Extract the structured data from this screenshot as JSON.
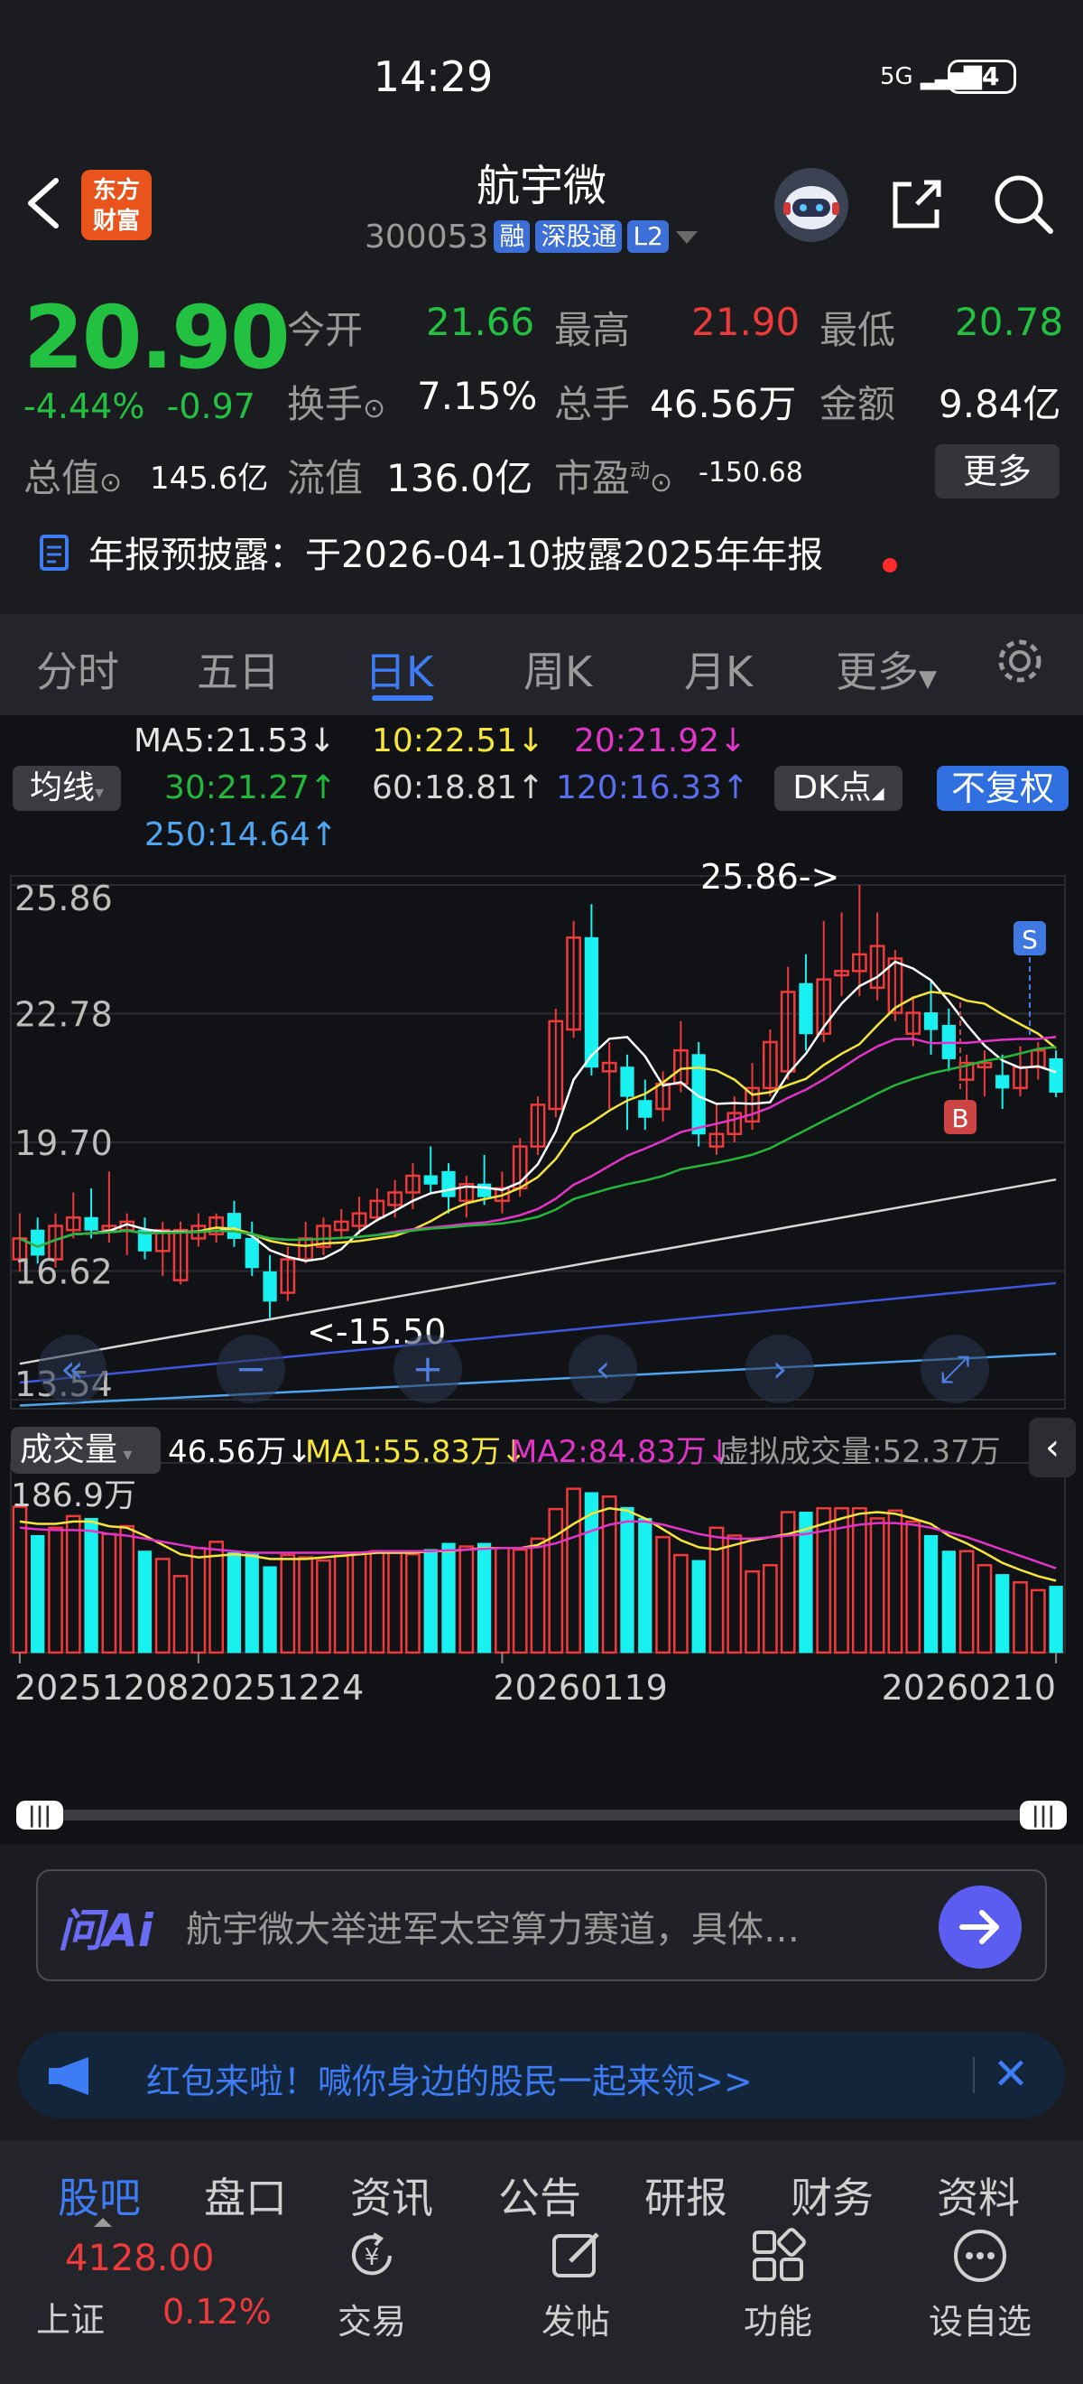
{
  "status": {
    "time": "14:29",
    "signal": "5G",
    "battery": "84"
  },
  "header": {
    "logo_line1": "东方",
    "logo_line2": "财富",
    "name": "航宇微",
    "code": "300053",
    "tags": [
      "融",
      "深股通",
      "L2"
    ]
  },
  "quote": {
    "price": "20.90",
    "change_pct": "-4.44%",
    "change": "-0.97",
    "labels": {
      "open": "今开",
      "high": "最高",
      "low": "最低",
      "turnover": "换手",
      "volume": "总手",
      "amount": "金额",
      "mktcap": "总值",
      "float": "流值",
      "pe": "市盈",
      "pe_sup": "动"
    },
    "values": {
      "open": "21.66",
      "high": "21.90",
      "low": "20.78",
      "turnover": "7.15%",
      "volume": "46.56万",
      "amount": "9.84亿",
      "mktcap": "145.6亿",
      "float": "136.0亿",
      "pe": "-150.68"
    },
    "more": "更多"
  },
  "notice": {
    "text": "年报预披露：于2026-04-10披露2025年年报"
  },
  "tabs": [
    "分时",
    "五日",
    "日K",
    "周K",
    "月K",
    "更多"
  ],
  "chart_controls": {
    "ma_chip": "均线",
    "dk_chip": "DK点",
    "fq_button": "不复权"
  },
  "ma_legend": {
    "ma5": "MA5:21.53↓",
    "ma10": "10:22.51↓",
    "ma20": "20:21.92↓",
    "ma30": "30:21.27↑",
    "ma60": "60:18.81↑",
    "ma120": "120:16.33↑",
    "ma250": "250:14.64↑"
  },
  "colors": {
    "ma5": "#ffffff",
    "ma10": "#f6e53a",
    "ma20": "#e234c8",
    "ma30": "#22b83a",
    "ma60": "#d8d8d8",
    "ma120": "#3f57e0",
    "ma250": "#4fa6f0",
    "up": "#ee3a3a",
    "down": "#19f0f0"
  },
  "volume_header": {
    "chip": "成交量",
    "vol": "46.56万↓",
    "ma1": "MA1:55.83万↓",
    "ma2": "MA2:84.83万↓",
    "virtual": "虚拟成交量:52.37万"
  },
  "chart_data": {
    "type": "candlestick",
    "y_ticks": [
      "25.86",
      "22.78",
      "19.70",
      "16.62",
      "13.54"
    ],
    "ylim": [
      13.54,
      25.86
    ],
    "annotations": {
      "high_label": "25.86->",
      "low_label": "<-15.50",
      "sell_marker": "S",
      "buy_marker": "B"
    },
    "x_labels": [
      "20251208",
      "20251224",
      "20260119",
      "20260210"
    ],
    "vol_max_label": "186.9万",
    "candles": [
      {
        "o": 16.9,
        "c": 17.4,
        "h": 18.0,
        "l": 16.6
      },
      {
        "o": 17.6,
        "c": 17.0,
        "h": 17.9,
        "l": 16.8
      },
      {
        "o": 16.9,
        "c": 17.7,
        "h": 18.0,
        "l": 16.7
      },
      {
        "o": 17.6,
        "c": 17.9,
        "h": 18.5,
        "l": 17.4
      },
      {
        "o": 17.9,
        "c": 17.6,
        "h": 18.6,
        "l": 17.4
      },
      {
        "o": 17.6,
        "c": 17.7,
        "h": 19.0,
        "l": 17.3
      },
      {
        "o": 17.6,
        "c": 17.8,
        "h": 18.0,
        "l": 17.0
      },
      {
        "o": 17.6,
        "c": 17.1,
        "h": 17.9,
        "l": 16.9
      },
      {
        "o": 17.1,
        "c": 17.6,
        "h": 17.8,
        "l": 16.5
      },
      {
        "o": 16.4,
        "c": 17.6,
        "h": 17.8,
        "l": 16.3
      },
      {
        "o": 17.4,
        "c": 17.7,
        "h": 18.0,
        "l": 17.2
      },
      {
        "o": 17.5,
        "c": 17.9,
        "h": 18.0,
        "l": 17.3
      },
      {
        "o": 18.0,
        "c": 17.4,
        "h": 18.3,
        "l": 17.2
      },
      {
        "o": 17.4,
        "c": 16.7,
        "h": 17.8,
        "l": 16.5
      },
      {
        "o": 16.6,
        "c": 15.9,
        "h": 17.0,
        "l": 15.5
      },
      {
        "o": 16.1,
        "c": 16.9,
        "h": 17.2,
        "l": 15.9
      },
      {
        "o": 16.9,
        "c": 17.4,
        "h": 17.8,
        "l": 16.8
      },
      {
        "o": 17.2,
        "c": 17.7,
        "h": 17.9,
        "l": 17.0
      },
      {
        "o": 17.6,
        "c": 17.8,
        "h": 18.1,
        "l": 17.4
      },
      {
        "o": 17.7,
        "c": 18.0,
        "h": 18.4,
        "l": 17.5
      },
      {
        "o": 17.9,
        "c": 18.3,
        "h": 18.6,
        "l": 17.8
      },
      {
        "o": 18.2,
        "c": 18.5,
        "h": 18.8,
        "l": 17.9
      },
      {
        "o": 18.5,
        "c": 18.9,
        "h": 19.2,
        "l": 18.1
      },
      {
        "o": 18.9,
        "c": 18.7,
        "h": 19.6,
        "l": 18.5
      },
      {
        "o": 19.0,
        "c": 18.4,
        "h": 19.2,
        "l": 18.0
      },
      {
        "o": 18.3,
        "c": 18.7,
        "h": 18.9,
        "l": 17.9
      },
      {
        "o": 18.7,
        "c": 18.4,
        "h": 19.4,
        "l": 18.2
      },
      {
        "o": 18.3,
        "c": 18.6,
        "h": 19.0,
        "l": 18.0
      },
      {
        "o": 18.6,
        "c": 19.6,
        "h": 19.8,
        "l": 18.4
      },
      {
        "o": 19.6,
        "c": 20.6,
        "h": 20.8,
        "l": 19.4
      },
      {
        "o": 20.5,
        "c": 22.6,
        "h": 22.9,
        "l": 20.3
      },
      {
        "o": 22.4,
        "c": 24.6,
        "h": 25.0,
        "l": 22.2
      },
      {
        "o": 24.6,
        "c": 21.5,
        "h": 25.4,
        "l": 21.3
      },
      {
        "o": 21.4,
        "c": 21.6,
        "h": 22.1,
        "l": 20.5
      },
      {
        "o": 21.5,
        "c": 20.8,
        "h": 21.8,
        "l": 20.0
      },
      {
        "o": 20.7,
        "c": 20.3,
        "h": 21.2,
        "l": 20.0
      },
      {
        "o": 20.5,
        "c": 21.1,
        "h": 21.4,
        "l": 20.2
      },
      {
        "o": 21.1,
        "c": 21.9,
        "h": 22.6,
        "l": 20.9
      },
      {
        "o": 21.8,
        "c": 19.9,
        "h": 22.1,
        "l": 19.6
      },
      {
        "o": 19.6,
        "c": 19.9,
        "h": 20.6,
        "l": 19.4
      },
      {
        "o": 19.9,
        "c": 20.4,
        "h": 20.8,
        "l": 19.7
      },
      {
        "o": 20.2,
        "c": 21.0,
        "h": 21.6,
        "l": 20.0
      },
      {
        "o": 21.0,
        "c": 22.1,
        "h": 22.4,
        "l": 20.8
      },
      {
        "o": 21.4,
        "c": 23.3,
        "h": 23.9,
        "l": 21.2
      },
      {
        "o": 23.5,
        "c": 22.3,
        "h": 24.2,
        "l": 21.9
      },
      {
        "o": 22.3,
        "c": 23.6,
        "h": 25.0,
        "l": 22.1
      },
      {
        "o": 23.7,
        "c": 23.8,
        "h": 25.2,
        "l": 23.2
      },
      {
        "o": 23.8,
        "c": 24.2,
        "h": 25.86,
        "l": 23.2
      },
      {
        "o": 23.4,
        "c": 24.4,
        "h": 25.2,
        "l": 23.1
      },
      {
        "o": 22.8,
        "c": 24.1,
        "h": 24.3,
        "l": 22.6
      },
      {
        "o": 22.3,
        "c": 22.8,
        "h": 23.2,
        "l": 22.0
      },
      {
        "o": 22.8,
        "c": 22.4,
        "h": 23.6,
        "l": 21.8
      },
      {
        "o": 22.5,
        "c": 21.7,
        "h": 22.9,
        "l": 21.4
      },
      {
        "o": 21.2,
        "c": 21.6,
        "h": 21.8,
        "l": 20.3
      },
      {
        "o": 21.5,
        "c": 21.6,
        "h": 21.9,
        "l": 20.8
      },
      {
        "o": 21.3,
        "c": 21.0,
        "h": 21.8,
        "l": 20.5
      },
      {
        "o": 21.0,
        "c": 21.5,
        "h": 22.0,
        "l": 20.8
      },
      {
        "o": 21.5,
        "c": 21.9,
        "h": 22.1,
        "l": 21.2
      },
      {
        "o": 21.7,
        "c": 20.9,
        "h": 21.9,
        "l": 20.78
      }
    ],
    "volumes": [
      186.9,
      150,
      160,
      175,
      172,
      152,
      162,
      130,
      120,
      98,
      134,
      142,
      128,
      128,
      110,
      125,
      122,
      118,
      124,
      128,
      130,
      128,
      126,
      132,
      140,
      136,
      140,
      134,
      132,
      146,
      184,
      210,
      205,
      200,
      186,
      172,
      148,
      125,
      118,
      160,
      150,
      104,
      112,
      180,
      180,
      185,
      185,
      185,
      172,
      182,
      168,
      150,
      130,
      130,
      112,
      100,
      90,
      80,
      85
    ],
    "ma1": [
      168,
      165,
      165,
      168,
      168,
      162,
      160,
      150,
      138,
      126,
      122,
      124,
      126,
      124,
      120,
      120,
      120,
      122,
      124,
      126,
      128,
      128,
      128,
      130,
      130,
      132,
      134,
      134,
      134,
      138,
      150,
      165,
      178,
      185,
      182,
      172,
      158,
      144,
      135,
      132,
      138,
      144,
      148,
      152,
      158,
      165,
      172,
      178,
      180,
      178,
      172,
      165,
      150,
      140,
      128,
      115,
      106,
      98,
      92
    ],
    "ma2": [
      160,
      158,
      157,
      157,
      156,
      152,
      150,
      146,
      142,
      138,
      134,
      132,
      130,
      128,
      128,
      128,
      128,
      128,
      128,
      128,
      130,
      130,
      130,
      130,
      131,
      132,
      133,
      134,
      134,
      135,
      140,
      148,
      156,
      164,
      168,
      168,
      164,
      158,
      152,
      148,
      146,
      146,
      148,
      150,
      152,
      156,
      160,
      164,
      166,
      166,
      164,
      160,
      154,
      148,
      140,
      132,
      124,
      116,
      108
    ]
  },
  "chart_nav_icons": [
    "rewind-icon",
    "zoom-out-icon",
    "zoom-in-icon",
    "prev-icon",
    "next-icon",
    "fullscreen-icon"
  ],
  "ai": {
    "logo": "问Ai",
    "placeholder": "航宇微大举进军太空算力赛道，具体…"
  },
  "promo": {
    "text": "红包来啦！喊你身边的股民一起来领>>"
  },
  "bottom_tabs": [
    "股吧",
    "盘口",
    "资讯",
    "公告",
    "研报",
    "财务",
    "资料"
  ],
  "index": {
    "value": "4128.00",
    "name": "上证",
    "pct": "0.12%"
  },
  "bottom_actions": [
    "交易",
    "发帖",
    "功能",
    "设自选"
  ]
}
